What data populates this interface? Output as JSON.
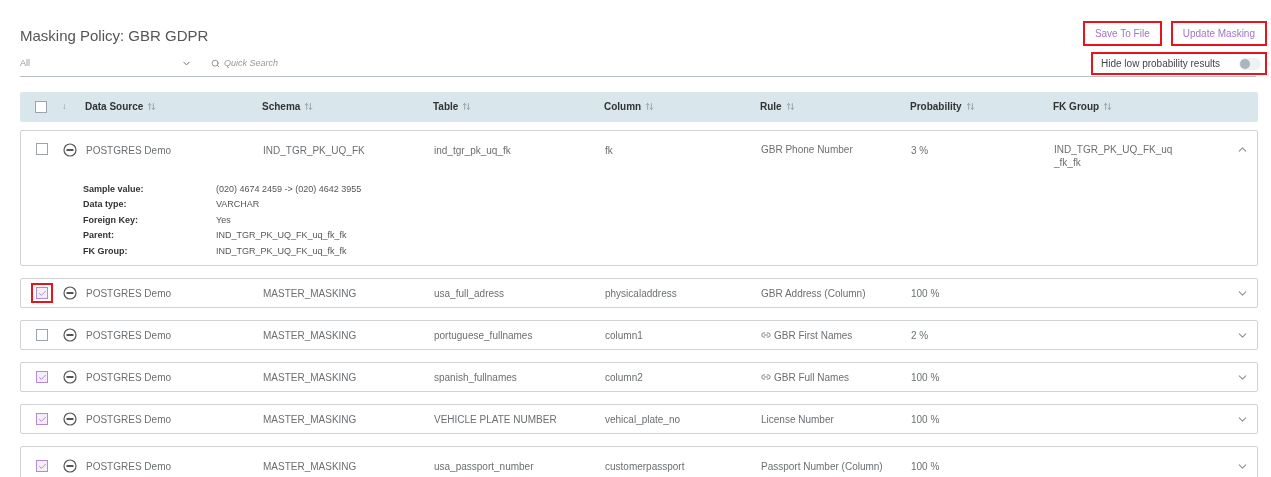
{
  "title": "Masking Policy: GBR GDPR",
  "buttons": [
    {
      "label": "Save To File",
      "highlighted": true
    },
    {
      "label": "Update Masking",
      "highlighted": true
    }
  ],
  "filter": {
    "value": "All"
  },
  "search": {
    "placeholder": "Quick Search"
  },
  "toggle": {
    "label": "Hide low probability results",
    "on": false,
    "highlighted": true
  },
  "table": {
    "select_all": {
      "checked": false
    },
    "sort_arrow": "↓",
    "columns": [
      {
        "label": "Data Source"
      },
      {
        "label": "Schema"
      },
      {
        "label": "Table"
      },
      {
        "label": "Column"
      },
      {
        "label": "Rule"
      },
      {
        "label": "Probability"
      },
      {
        "label": "FK Group"
      }
    ],
    "rows": [
      {
        "checked": false,
        "highlighted": false,
        "expanded": true,
        "data_source": "POSTGRES Demo",
        "schema": "IND_TGR_PK_UQ_FK",
        "table": "ind_tgr_pk_uq_fk",
        "column": "fk",
        "rule": "GBR Phone Number",
        "linked": false,
        "probability": "3 %",
        "fk_group": "IND_TGR_PK_UQ_FK_uq _fk_fk",
        "details": [
          {
            "label": "Sample value:",
            "value": "(020) 4674 2459 -> (020) 4642 3955"
          },
          {
            "label": "Data type:",
            "value": "VARCHAR"
          },
          {
            "label": "Foreign Key:",
            "value": "Yes"
          },
          {
            "label": "Parent:",
            "value": "IND_TGR_PK_UQ_FK_uq_fk_fk"
          },
          {
            "label": "FK Group:",
            "value": "IND_TGR_PK_UQ_FK_uq_fk_fk"
          }
        ]
      },
      {
        "checked": true,
        "highlighted": true,
        "expanded": false,
        "data_source": "POSTGRES Demo",
        "schema": "MASTER_MASKING",
        "table": "usa_full_adress",
        "column": "physicaladdress",
        "rule": "GBR Address (Column)",
        "linked": false,
        "probability": "100 %"
      },
      {
        "checked": false,
        "highlighted": false,
        "expanded": false,
        "data_source": "POSTGRES Demo",
        "schema": "MASTER_MASKING",
        "table": "portuguese_fullnames",
        "column": "column1",
        "rule": "GBR First Names",
        "linked": true,
        "probability": "2 %"
      },
      {
        "checked": true,
        "highlighted": false,
        "expanded": false,
        "data_source": "POSTGRES Demo",
        "schema": "MASTER_MASKING",
        "table": "spanish_fullnames",
        "column": "column2",
        "rule": "GBR Full Names",
        "linked": true,
        "probability": "100 %"
      },
      {
        "checked": true,
        "highlighted": false,
        "expanded": false,
        "data_source": "POSTGRES Demo",
        "schema": "MASTER_MASKING",
        "table": "VEHICLE PLATE NUMBER",
        "column": "vehical_plate_no",
        "rule": "License Number",
        "linked": false,
        "probability": "100 %"
      },
      {
        "checked": true,
        "highlighted": false,
        "expanded": false,
        "data_source": "POSTGRES Demo",
        "schema": "MASTER_MASKING",
        "table": "usa_passport_number",
        "column": "customerpassport",
        "rule": "Passport Number (Column)",
        "linked": false,
        "probability": "100 %"
      }
    ]
  }
}
